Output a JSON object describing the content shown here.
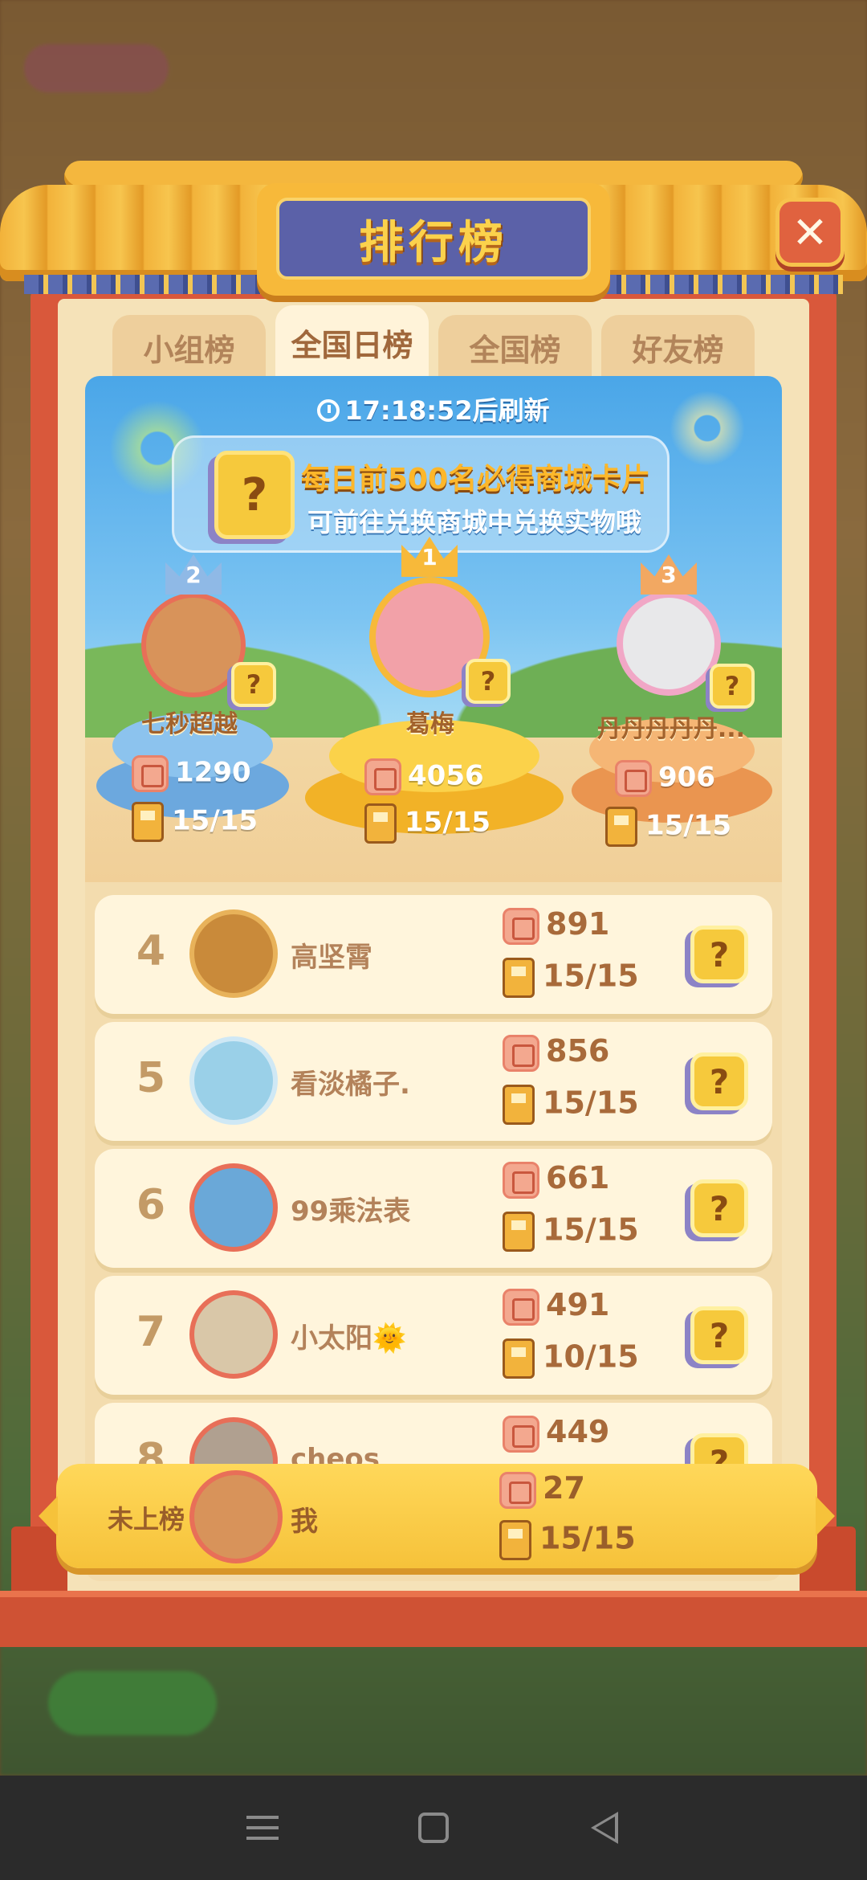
{
  "title": "排行榜",
  "close_label": "✕",
  "tabs": [
    {
      "label": "小组榜",
      "active": false
    },
    {
      "label": "全国日榜",
      "active": true
    },
    {
      "label": "全国榜",
      "active": false
    },
    {
      "label": "好友榜",
      "active": false
    }
  ],
  "refresh": {
    "time": "17:18:52",
    "suffix": "后刷新"
  },
  "banner": {
    "line1": "每日前500名必得商城卡片",
    "line2": "可前往兑换商城中兑换实物哦",
    "card_mark": "?"
  },
  "podium": [
    {
      "rank": "2",
      "name": "七秒超越",
      "score": "1290",
      "progress": "15/15",
      "color": "#7fb6e6"
    },
    {
      "rank": "1",
      "name": "葛梅",
      "score": "4056",
      "progress": "15/15",
      "color": "#f7c23a"
    },
    {
      "rank": "3",
      "name": "丹丹丹丹丹...",
      "score": "906",
      "progress": "15/15",
      "color": "#f2a862"
    }
  ],
  "rows": [
    {
      "rank": "4",
      "name": "高坚霄",
      "score": "891",
      "progress": "15/15",
      "avatar_color": "#c98a3a"
    },
    {
      "rank": "5",
      "name": "看淡橘子.",
      "score": "856",
      "progress": "15/15",
      "avatar_color": "#9ad0e8"
    },
    {
      "rank": "6",
      "name": "99乘法表",
      "score": "661",
      "progress": "15/15",
      "avatar_color": "#6aa8d8"
    },
    {
      "rank": "7",
      "name": "小太阳🌞",
      "score": "491",
      "progress": "10/15",
      "avatar_color": "#d9c7a8"
    },
    {
      "rank": "8",
      "name": "cheos",
      "score": "449",
      "progress": "",
      "avatar_color": "#b0a090"
    }
  ],
  "me": {
    "rank": "未上榜",
    "name": "我",
    "score": "27",
    "progress": "15/15"
  },
  "card_mark": "?"
}
